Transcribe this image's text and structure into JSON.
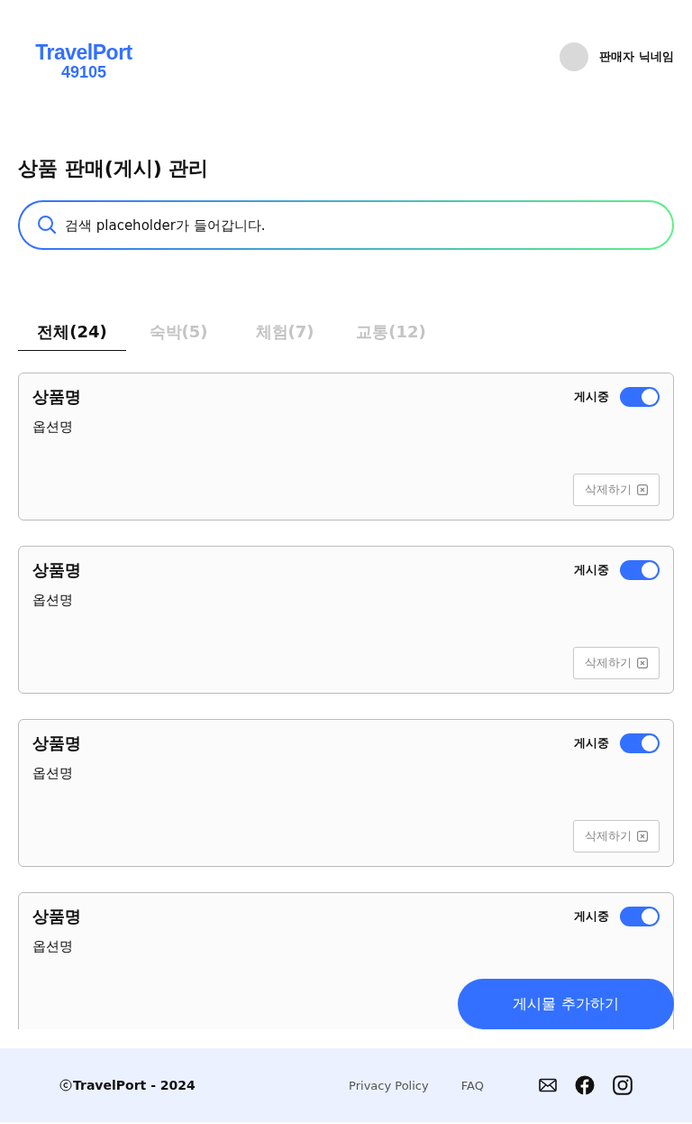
{
  "header": {
    "logo_line_1": "TravelPort",
    "logo_line_2": "49105",
    "user_name": "판매자 닉네임"
  },
  "page_title": "상품 판매(게시) 관리",
  "search": {
    "placeholder": "검색 placeholder가 들어갑니다."
  },
  "tabs": [
    {
      "label": "전체(24)",
      "selected": true
    },
    {
      "label": "숙박(5)",
      "selected": false
    },
    {
      "label": "체험(7)",
      "selected": false
    },
    {
      "label": "교통(12)",
      "selected": false
    }
  ],
  "products": [
    {
      "name": "상품명",
      "option": "옵션명",
      "status_label": "게시중",
      "on": true,
      "delete_label": "삭제하기"
    },
    {
      "name": "상품명",
      "option": "옵션명",
      "status_label": "게시중",
      "on": true,
      "delete_label": "삭제하기"
    },
    {
      "name": "상품명",
      "option": "옵션명",
      "status_label": "게시중",
      "on": true,
      "delete_label": "삭제하기"
    },
    {
      "name": "상품명",
      "option": "옵션명",
      "status_label": "게시중",
      "on": true
    }
  ],
  "add_button": "게시물 추가하기",
  "footer": {
    "copyright": "TravelPort - 2024",
    "links": [
      "Privacy Policy",
      "FAQ"
    ]
  }
}
